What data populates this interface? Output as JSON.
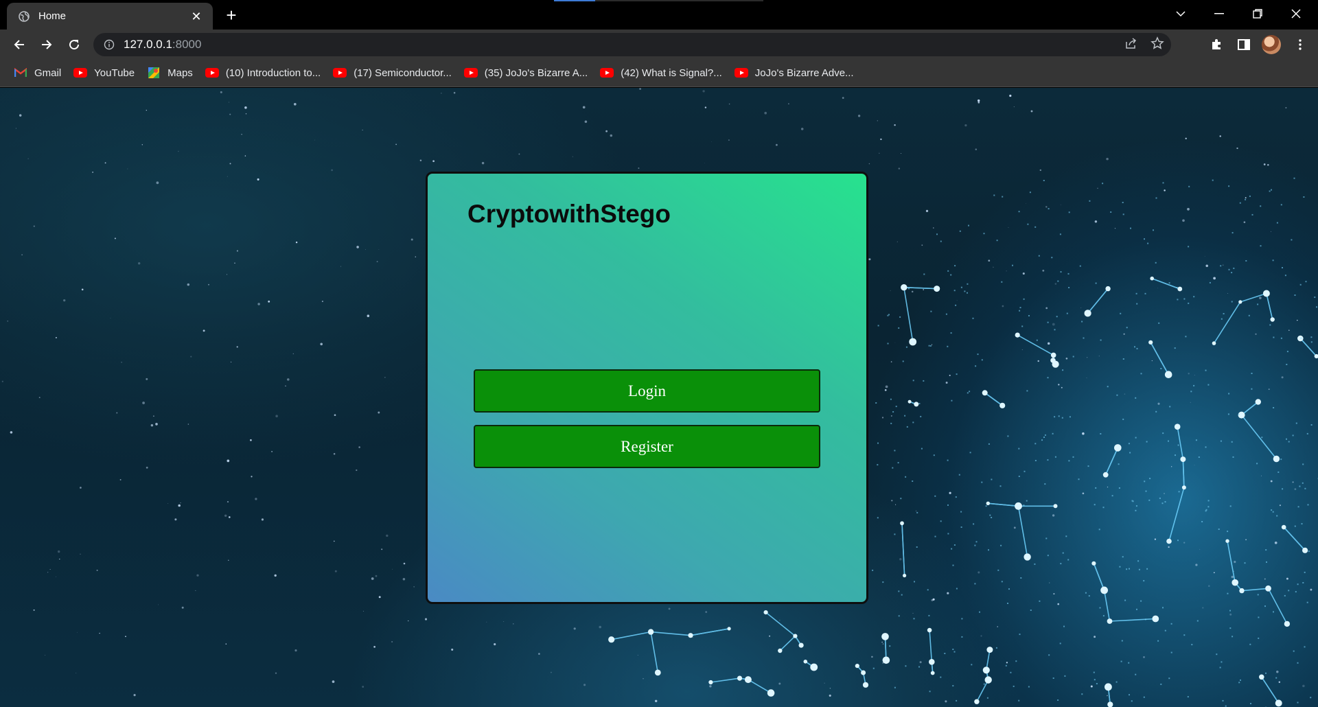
{
  "browser": {
    "tab": {
      "title": "Home",
      "close_glyph": "✕"
    },
    "new_tab_glyph": "+",
    "url": {
      "host": "127.0.0.1",
      "port": ":8000"
    },
    "bookmarks": [
      {
        "label": "Gmail",
        "icon": "gmail-icon"
      },
      {
        "label": "YouTube",
        "icon": "youtube-icon"
      },
      {
        "label": "Maps",
        "icon": "maps-icon"
      },
      {
        "label": "(10) Introduction to...",
        "icon": "youtube-icon"
      },
      {
        "label": "(17) Semiconductor...",
        "icon": "youtube-icon"
      },
      {
        "label": "(35) JoJo's Bizarre A...",
        "icon": "youtube-icon"
      },
      {
        "label": "(42) What is Signal?...",
        "icon": "youtube-icon"
      },
      {
        "label": "JoJo's Bizarre Adve...",
        "icon": "youtube-icon"
      }
    ]
  },
  "card": {
    "brand": "CryptowithStego",
    "login_label": "Login",
    "register_label": "Register"
  },
  "colors": {
    "button_green": "#0a9009",
    "card_gradient_start": "#4a8ac4",
    "card_gradient_end": "#27e28e"
  }
}
